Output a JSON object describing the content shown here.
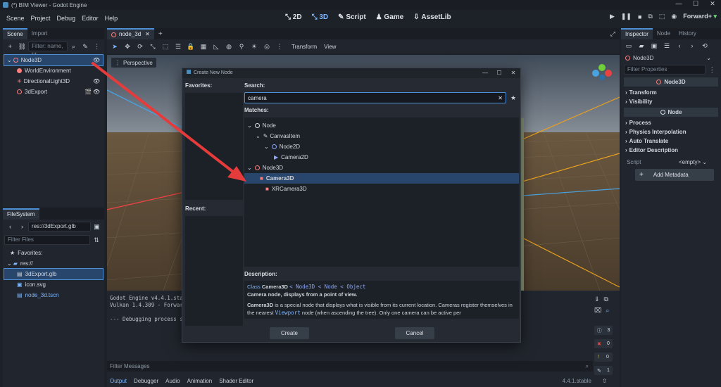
{
  "window": {
    "title": "(*) BIM Viewer - Godot Engine",
    "controls": [
      "—",
      "☐",
      "✕"
    ]
  },
  "menu": [
    "Scene",
    "Project",
    "Debug",
    "Editor",
    "Help"
  ],
  "workspaces": [
    "2D",
    "3D",
    "Script",
    "Game",
    "AssetLib"
  ],
  "renderer": "Forward+",
  "scene_dock": {
    "tabs": [
      "Scene",
      "Import"
    ],
    "filter_placeholder": "Filter: name, t:t",
    "nodes": [
      {
        "label": "Node3D"
      },
      {
        "label": "WorldEnvironment"
      },
      {
        "label": "DirectionalLight3D"
      },
      {
        "label": "3dExport"
      }
    ]
  },
  "filesystem": {
    "tab": "FileSystem",
    "path": "res://3dExport.glb",
    "filter_placeholder": "Filter Files",
    "items": [
      {
        "label": "Favorites:"
      },
      {
        "label": "res://"
      },
      {
        "label": "3dExport.glb"
      },
      {
        "label": "icon.svg"
      },
      {
        "label": "node_3d.tscn"
      }
    ]
  },
  "editor": {
    "tab": "node_3d",
    "menus": [
      "Transform",
      "View"
    ],
    "perspective": "Perspective"
  },
  "output": {
    "lines": [
      "Godot Engine v4.4.1.stabl",
      "Vulkan 1.4.309 - Forward",
      "",
      "--- Debugging process st"
    ],
    "filter_placeholder": "Filter Messages",
    "tabs": [
      "Output",
      "Debugger",
      "Audio",
      "Animation",
      "Shader Editor"
    ],
    "version": "4.4.1.stable",
    "counts": [
      "3",
      "0",
      "0",
      "1"
    ]
  },
  "inspector": {
    "tabs": [
      "Inspector",
      "Node",
      "History"
    ],
    "node": "Node3D",
    "filter_placeholder": "Filter Properties",
    "class_header": "Node3D",
    "sections1": [
      "Transform",
      "Visibility"
    ],
    "class_header2": "Node",
    "sections2": [
      "Process",
      "Physics Interpolation",
      "Auto Translate",
      "Editor Description"
    ],
    "script_label": "Script",
    "script_value": "<empty>",
    "add_metadata": "Add Metadata"
  },
  "dialog": {
    "title": "Create New Node",
    "favorites": "Favorites:",
    "recent": "Recent:",
    "search_label": "Search:",
    "search_value": "camera",
    "matches": "Matches:",
    "tree": [
      {
        "label": "Node"
      },
      {
        "label": "CanvasItem"
      },
      {
        "label": "Node2D"
      },
      {
        "label": "Camera2D"
      },
      {
        "label": "Node3D"
      },
      {
        "label": "Camera3D"
      },
      {
        "label": "XRCamera3D"
      }
    ],
    "description_label": "Description:",
    "class_line": {
      "prefix": "Class",
      "name": "Camera3D",
      "inherits": "< Node3D < Node < Object"
    },
    "summary": "Camera node, displays from a point of view.",
    "body_bold": "Camera3D",
    "body": " is a special node that displays what is visible from its current location. Cameras register themselves in the nearest ",
    "body_code": "Viewport",
    "body_end": " node (when ascending the tree). Only one camera can be active per",
    "create": "Create",
    "cancel": "Cancel"
  },
  "colors": {
    "accent": "#4f8fd6",
    "node3d": "#fc7f7f",
    "node2d": "#8da5f3",
    "selection": "#28466b",
    "annotation_arrow": "#e63b3b"
  }
}
